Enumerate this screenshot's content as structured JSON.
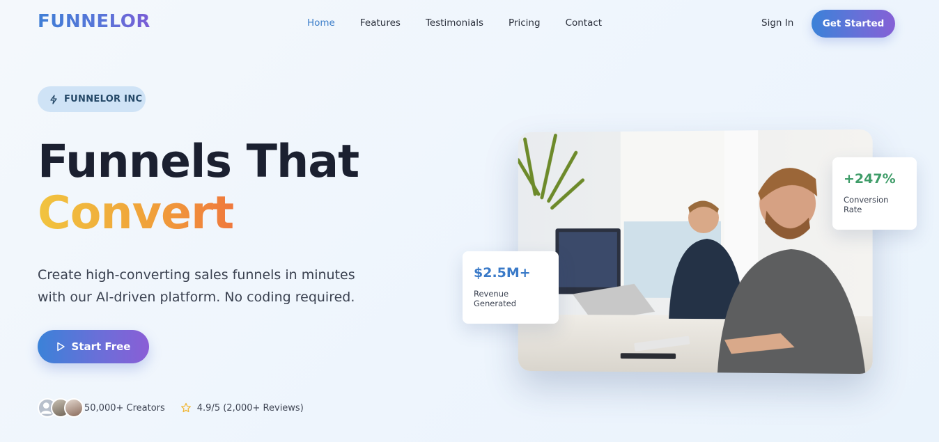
{
  "nav": {
    "logo": "FUNNELOR",
    "links": [
      "Home",
      "Features",
      "Testimonials",
      "Pricing",
      "Contact"
    ],
    "active": "Home",
    "sign_in": "Sign In",
    "cta": "Get Started"
  },
  "hero": {
    "badge": "FUNNELOR INC",
    "title_line1": "Funnels That",
    "title_line2": "Convert",
    "subtitle": "Create high-converting sales funnels in minutes with our AI-driven platform. No coding required.",
    "cta": "Start Free",
    "creators": "50,000+ Creators",
    "rating": "4.9/5 (2,000+ Reviews)"
  },
  "stats": {
    "revenue": {
      "value": "$2.5M+",
      "label": "Revenue Generated"
    },
    "conversion": {
      "value": "+247%",
      "label": "Conversion Rate"
    }
  },
  "colors": {
    "accent_blue": "#3b82d8",
    "accent_purple": "#8560d6",
    "convert_gradient_start": "#f1c43f",
    "convert_gradient_end": "#e8423f",
    "stat_green": "#3e9c68"
  }
}
